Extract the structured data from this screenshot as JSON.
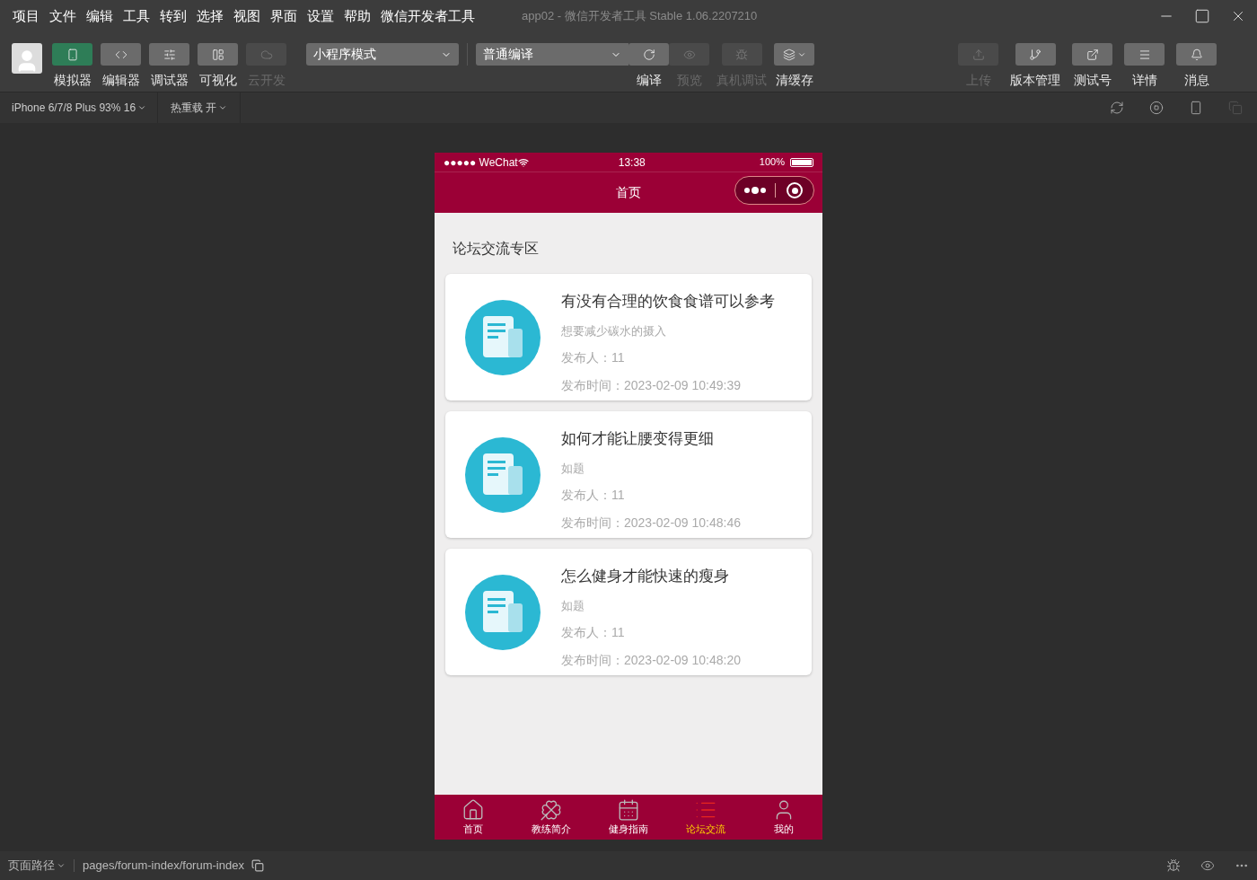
{
  "menu_bar": [
    "项目",
    "文件",
    "编辑",
    "工具",
    "转到",
    "选择",
    "视图",
    "界面",
    "设置",
    "帮助",
    "微信开发者工具"
  ],
  "window": {
    "title": "app02 - 微信开发者工具 Stable 1.06.2207210"
  },
  "left_tools": [
    {
      "label": "模拟器",
      "selected": true,
      "disabled": false
    },
    {
      "label": "编辑器",
      "selected": false,
      "disabled": false
    },
    {
      "label": "调试器",
      "selected": false,
      "disabled": false
    },
    {
      "label": "可视化",
      "selected": false,
      "disabled": false
    },
    {
      "label": "云开发",
      "selected": false,
      "disabled": true
    }
  ],
  "mode_select": {
    "value": "小程序模式"
  },
  "compile_select": {
    "value": "普通编译"
  },
  "compile_tools": [
    {
      "label": "编译",
      "disabled": false
    },
    {
      "label": "预览",
      "disabled": true
    },
    {
      "label": "真机调试",
      "disabled": true
    },
    {
      "label": "清缓存",
      "disabled": false
    }
  ],
  "right_tools": [
    {
      "label": "上传",
      "disabled": true
    },
    {
      "label": "版本管理",
      "disabled": false
    },
    {
      "label": "测试号",
      "disabled": false
    },
    {
      "label": "详情",
      "disabled": false
    },
    {
      "label": "消息",
      "disabled": false
    }
  ],
  "sub_toolbar": {
    "device": "iPhone 6/7/8 Plus 93% 16",
    "hot_reload": "热重载 开"
  },
  "phone": {
    "carrier": "●●●●● WeChat",
    "time": "13:38",
    "battery": "100%",
    "nav_title": "首页",
    "section_title": "论坛交流专区",
    "posts": [
      {
        "title": "有没有合理的饮食食谱可以参考",
        "subtitle": "想要减少碳水的摄入",
        "publisher": "发布人：11",
        "time": "发布时间：2023-02-09 10:49:39"
      },
      {
        "title": "如何才能让腰变得更细",
        "subtitle": "如题",
        "publisher": "发布人：11",
        "time": "发布时间：2023-02-09 10:48:46"
      },
      {
        "title": "怎么健身才能快速的瘦身",
        "subtitle": "如题",
        "publisher": "发布人：11",
        "time": "发布时间：2023-02-09 10:48:20"
      }
    ],
    "tab_bar": [
      {
        "label": "首页",
        "selected": false
      },
      {
        "label": "教练简介",
        "selected": false
      },
      {
        "label": "健身指南",
        "selected": false
      },
      {
        "label": "论坛交流",
        "selected": true
      },
      {
        "label": "我的",
        "selected": false
      }
    ]
  },
  "status_bar": {
    "path_label": "页面路径",
    "path": "pages/forum-index/forum-index"
  }
}
